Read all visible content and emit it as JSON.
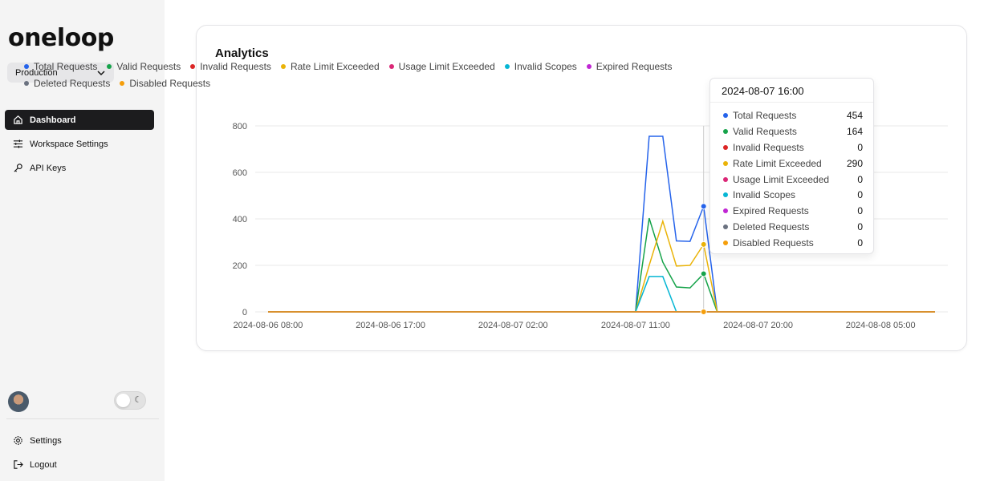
{
  "sidebar": {
    "logo": "oneloop",
    "environment": "Production",
    "nav": [
      {
        "label": "Dashboard",
        "icon": "home-icon",
        "active": true
      },
      {
        "label": "Workspace Settings",
        "icon": "sliders-icon"
      },
      {
        "label": "API Keys",
        "icon": "key-icon"
      }
    ],
    "bottom": [
      {
        "label": "Settings",
        "icon": "gear-icon"
      },
      {
        "label": "Logout",
        "icon": "logout-icon"
      }
    ],
    "theme_toggle": {
      "on": false,
      "icon": "moon-icon"
    }
  },
  "card": {
    "title": "Analytics"
  },
  "tooltip": {
    "title": "2024-08-07 16:00",
    "rows": [
      {
        "label": "Total Requests",
        "value": "454"
      },
      {
        "label": "Valid Requests",
        "value": "164"
      },
      {
        "label": "Invalid Requests",
        "value": "0"
      },
      {
        "label": "Rate Limit Exceeded",
        "value": "290"
      },
      {
        "label": "Usage Limit Exceeded",
        "value": "0"
      },
      {
        "label": "Invalid Scopes",
        "value": "0"
      },
      {
        "label": "Expired Requests",
        "value": "0"
      },
      {
        "label": "Deleted Requests",
        "value": "0"
      },
      {
        "label": "Disabled Requests",
        "value": "0"
      }
    ]
  },
  "chart_data": {
    "type": "line",
    "ylim": [
      0,
      800
    ],
    "yticks": [
      0,
      200,
      400,
      600,
      800
    ],
    "grid": true,
    "legend": "top",
    "xticks": [
      "2024-08-06 08:00",
      "2024-08-06 17:00",
      "2024-08-07 02:00",
      "2024-08-07 11:00",
      "2024-08-07 20:00",
      "2024-08-08 05:00"
    ],
    "hover_x": "2024-08-07 16:00",
    "x": [
      "2024-08-06 08:00",
      "2024-08-06 09:00",
      "2024-08-06 10:00",
      "2024-08-06 11:00",
      "2024-08-06 12:00",
      "2024-08-06 13:00",
      "2024-08-06 14:00",
      "2024-08-06 15:00",
      "2024-08-06 16:00",
      "2024-08-06 17:00",
      "2024-08-06 18:00",
      "2024-08-06 19:00",
      "2024-08-06 20:00",
      "2024-08-06 21:00",
      "2024-08-06 22:00",
      "2024-08-06 23:00",
      "2024-08-07 00:00",
      "2024-08-07 01:00",
      "2024-08-07 02:00",
      "2024-08-07 03:00",
      "2024-08-07 04:00",
      "2024-08-07 05:00",
      "2024-08-07 06:00",
      "2024-08-07 07:00",
      "2024-08-07 08:00",
      "2024-08-07 09:00",
      "2024-08-07 10:00",
      "2024-08-07 11:00",
      "2024-08-07 12:00",
      "2024-08-07 13:00",
      "2024-08-07 14:00",
      "2024-08-07 15:00",
      "2024-08-07 16:00",
      "2024-08-07 17:00",
      "2024-08-07 18:00",
      "2024-08-07 19:00",
      "2024-08-07 20:00",
      "2024-08-07 21:00",
      "2024-08-07 22:00",
      "2024-08-07 23:00",
      "2024-08-08 00:00",
      "2024-08-08 01:00",
      "2024-08-08 02:00",
      "2024-08-08 03:00",
      "2024-08-08 04:00",
      "2024-08-08 05:00",
      "2024-08-08 06:00",
      "2024-08-08 07:00",
      "2024-08-08 08:00",
      "2024-08-08 09:00"
    ],
    "series": [
      {
        "name": "Total Requests",
        "color": "#2563eb",
        "values": [
          0,
          0,
          0,
          0,
          0,
          0,
          0,
          0,
          0,
          0,
          0,
          0,
          0,
          0,
          0,
          0,
          0,
          0,
          0,
          0,
          0,
          0,
          0,
          0,
          0,
          0,
          0,
          0,
          755,
          755,
          305,
          303,
          454,
          0,
          0,
          0,
          0,
          0,
          0,
          0,
          0,
          0,
          0,
          0,
          0,
          0,
          0,
          0,
          0,
          0
        ]
      },
      {
        "name": "Valid Requests",
        "color": "#16a34a",
        "values": [
          0,
          0,
          0,
          0,
          0,
          0,
          0,
          0,
          0,
          0,
          0,
          0,
          0,
          0,
          0,
          0,
          0,
          0,
          0,
          0,
          0,
          0,
          0,
          0,
          0,
          0,
          0,
          0,
          403,
          214,
          107,
          103,
          164,
          0,
          0,
          0,
          0,
          0,
          0,
          0,
          0,
          0,
          0,
          0,
          0,
          0,
          0,
          0,
          0,
          0
        ]
      },
      {
        "name": "Invalid Requests",
        "color": "#dc2626",
        "values": [
          0,
          0,
          0,
          0,
          0,
          0,
          0,
          0,
          0,
          0,
          0,
          0,
          0,
          0,
          0,
          0,
          0,
          0,
          0,
          0,
          0,
          0,
          0,
          0,
          0,
          0,
          0,
          0,
          0,
          0,
          0,
          0,
          0,
          0,
          0,
          0,
          0,
          0,
          0,
          0,
          0,
          0,
          0,
          0,
          0,
          0,
          0,
          0,
          0,
          0
        ]
      },
      {
        "name": "Rate Limit Exceeded",
        "color": "#eab308",
        "values": [
          0,
          0,
          0,
          0,
          0,
          0,
          0,
          0,
          0,
          0,
          0,
          0,
          0,
          0,
          0,
          0,
          0,
          0,
          0,
          0,
          0,
          0,
          0,
          0,
          0,
          0,
          0,
          0,
          200,
          390,
          197,
          200,
          290,
          0,
          0,
          0,
          0,
          0,
          0,
          0,
          0,
          0,
          0,
          0,
          0,
          0,
          0,
          0,
          0,
          0
        ]
      },
      {
        "name": "Usage Limit Exceeded",
        "color": "#db2777",
        "values": [
          0,
          0,
          0,
          0,
          0,
          0,
          0,
          0,
          0,
          0,
          0,
          0,
          0,
          0,
          0,
          0,
          0,
          0,
          0,
          0,
          0,
          0,
          0,
          0,
          0,
          0,
          0,
          0,
          0,
          0,
          0,
          0,
          0,
          0,
          0,
          0,
          0,
          0,
          0,
          0,
          0,
          0,
          0,
          0,
          0,
          0,
          0,
          0,
          0,
          0
        ]
      },
      {
        "name": "Invalid Scopes",
        "color": "#06b6d4",
        "values": [
          0,
          0,
          0,
          0,
          0,
          0,
          0,
          0,
          0,
          0,
          0,
          0,
          0,
          0,
          0,
          0,
          0,
          0,
          0,
          0,
          0,
          0,
          0,
          0,
          0,
          0,
          0,
          0,
          152,
          152,
          0,
          0,
          0,
          0,
          0,
          0,
          0,
          0,
          0,
          0,
          0,
          0,
          0,
          0,
          0,
          0,
          0,
          0,
          0,
          0
        ]
      },
      {
        "name": "Expired Requests",
        "color": "#c026d3",
        "values": [
          0,
          0,
          0,
          0,
          0,
          0,
          0,
          0,
          0,
          0,
          0,
          0,
          0,
          0,
          0,
          0,
          0,
          0,
          0,
          0,
          0,
          0,
          0,
          0,
          0,
          0,
          0,
          0,
          0,
          0,
          0,
          0,
          0,
          0,
          0,
          0,
          0,
          0,
          0,
          0,
          0,
          0,
          0,
          0,
          0,
          0,
          0,
          0,
          0,
          0
        ]
      },
      {
        "name": "Deleted Requests",
        "color": "#6b7280",
        "values": [
          0,
          0,
          0,
          0,
          0,
          0,
          0,
          0,
          0,
          0,
          0,
          0,
          0,
          0,
          0,
          0,
          0,
          0,
          0,
          0,
          0,
          0,
          0,
          0,
          0,
          0,
          0,
          0,
          0,
          0,
          0,
          0,
          0,
          0,
          0,
          0,
          0,
          0,
          0,
          0,
          0,
          0,
          0,
          0,
          0,
          0,
          0,
          0,
          0,
          0
        ]
      },
      {
        "name": "Disabled Requests",
        "color": "#f59e0b",
        "values": [
          0,
          0,
          0,
          0,
          0,
          0,
          0,
          0,
          0,
          0,
          0,
          0,
          0,
          0,
          0,
          0,
          0,
          0,
          0,
          0,
          0,
          0,
          0,
          0,
          0,
          0,
          0,
          0,
          0,
          0,
          0,
          0,
          0,
          0,
          0,
          0,
          0,
          0,
          0,
          0,
          0,
          0,
          0,
          0,
          0,
          0,
          0,
          0,
          0,
          0
        ]
      }
    ]
  }
}
